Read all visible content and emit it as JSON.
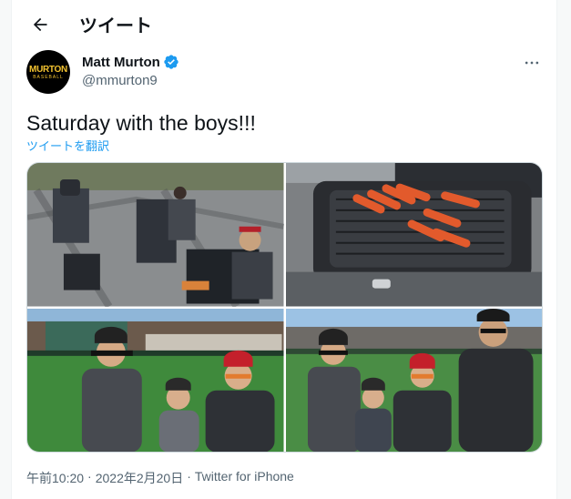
{
  "header": {
    "title": "ツイート",
    "back_icon": "arrow-left-icon"
  },
  "author": {
    "name": "Matt Murton",
    "handle": "@mmurton9",
    "avatar_logo": "MURTON",
    "avatar_logo_sub": "BASEBALL",
    "verified_icon": "verified-badge-icon",
    "verified_color": "#1d9bf0"
  },
  "tweet": {
    "text": "Saturday with the boys!!!",
    "translate_label": "ツイートを翻訳"
  },
  "media": [
    {
      "name": "photo-camp-chairs"
    },
    {
      "name": "photo-grill-hotdogs"
    },
    {
      "name": "photo-boys-stadium"
    },
    {
      "name": "photo-boys-with-father"
    }
  ],
  "meta": {
    "time": "午前10:20",
    "separator1": "·",
    "date": "2022年2月20日",
    "separator2": "·",
    "source": "Twitter for iPhone"
  },
  "colors": {
    "accent": "#1d9bf0",
    "secondary_text": "#536471",
    "border": "#cfd9de"
  }
}
